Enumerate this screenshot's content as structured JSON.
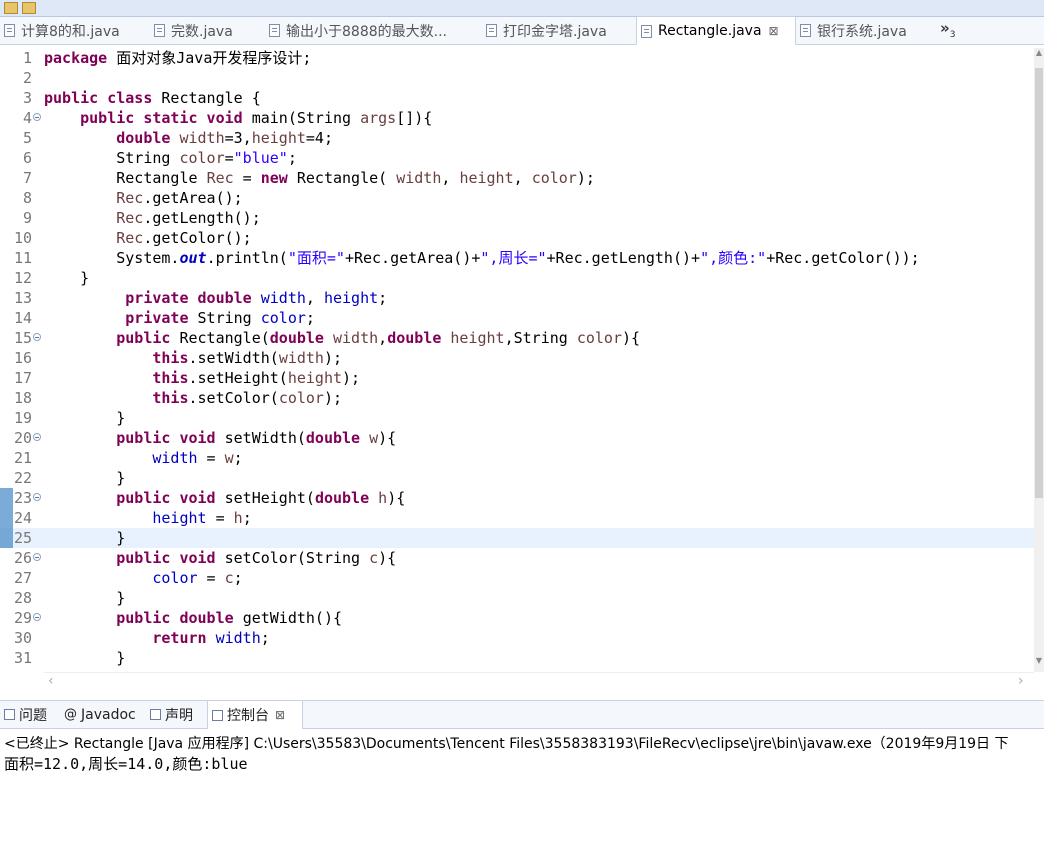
{
  "tabs": [
    {
      "label": "计算8的和.java",
      "active": false
    },
    {
      "label": "完数.java",
      "active": false
    },
    {
      "label": "输出小于8888的最大数...",
      "active": false
    },
    {
      "label": "打印金字塔.java",
      "active": false
    },
    {
      "label": "Rectangle.java",
      "active": true,
      "close": "⊠"
    },
    {
      "label": "银行系统.java",
      "active": false
    }
  ],
  "tabs_overflow": {
    "glyph": "»",
    "count": "3"
  },
  "editor": {
    "current_line": 25,
    "lines": [
      {
        "n": "1",
        "fold": false,
        "mark": false,
        "tokens": [
          [
            "package ",
            "kw"
          ],
          [
            "面对对象Java开发程序设计;",
            "p"
          ]
        ]
      },
      {
        "n": "2",
        "fold": false,
        "mark": false,
        "tokens": []
      },
      {
        "n": "3",
        "fold": false,
        "mark": false,
        "tokens": [
          [
            "public class ",
            "kw"
          ],
          [
            "Rectangle {",
            "p"
          ]
        ]
      },
      {
        "n": "4",
        "fold": true,
        "mark": false,
        "tokens": [
          [
            "    ",
            "p"
          ],
          [
            "public static void ",
            "kw"
          ],
          [
            "main(String ",
            "p"
          ],
          [
            "args",
            "lv"
          ],
          [
            "[]){",
            "p"
          ]
        ]
      },
      {
        "n": "5",
        "fold": false,
        "mark": false,
        "tokens": [
          [
            "        ",
            "p"
          ],
          [
            "double ",
            "kw"
          ],
          [
            "width",
            "lv"
          ],
          [
            "=3,",
            "p"
          ],
          [
            "height",
            "lv"
          ],
          [
            "=4;",
            "p"
          ]
        ]
      },
      {
        "n": "6",
        "fold": false,
        "mark": false,
        "tokens": [
          [
            "        String ",
            "p"
          ],
          [
            "color",
            "lv"
          ],
          [
            "=",
            "p"
          ],
          [
            "\"blue\"",
            "st"
          ],
          [
            ";",
            "p"
          ]
        ]
      },
      {
        "n": "7",
        "fold": false,
        "mark": false,
        "tokens": [
          [
            "        Rectangle ",
            "p"
          ],
          [
            "Rec",
            "lv"
          ],
          [
            " = ",
            "p"
          ],
          [
            "new ",
            "kw"
          ],
          [
            "Rectangle( ",
            "p"
          ],
          [
            "width",
            "lv"
          ],
          [
            ", ",
            "p"
          ],
          [
            "height",
            "lv"
          ],
          [
            ", ",
            "p"
          ],
          [
            "color",
            "lv"
          ],
          [
            ");",
            "p"
          ]
        ]
      },
      {
        "n": "8",
        "fold": false,
        "mark": false,
        "tokens": [
          [
            "        ",
            "p"
          ],
          [
            "Rec",
            "lv"
          ],
          [
            ".getArea();",
            "p"
          ]
        ]
      },
      {
        "n": "9",
        "fold": false,
        "mark": false,
        "tokens": [
          [
            "        ",
            "p"
          ],
          [
            "Rec",
            "lv"
          ],
          [
            ".getLength();",
            "p"
          ]
        ]
      },
      {
        "n": "10",
        "fold": false,
        "mark": false,
        "tokens": [
          [
            "        ",
            "p"
          ],
          [
            "Rec",
            "lv"
          ],
          [
            ".getColor();",
            "p"
          ]
        ]
      },
      {
        "n": "11",
        "fold": false,
        "mark": false,
        "tokens": [
          [
            "        System.",
            "p"
          ],
          [
            "out",
            "sf"
          ],
          [
            ".println(",
            "p"
          ],
          [
            "\"面积=\"",
            "st"
          ],
          [
            "+Rec.getArea()+",
            "p"
          ],
          [
            "\",周长=\"",
            "st"
          ],
          [
            "+Rec.getLength()+",
            "p"
          ],
          [
            "\",颜色:\"",
            "st"
          ],
          [
            "+Rec.getColor());",
            "p"
          ]
        ]
      },
      {
        "n": "12",
        "fold": false,
        "mark": false,
        "tokens": [
          [
            "    }",
            "p"
          ]
        ]
      },
      {
        "n": "13",
        "fold": false,
        "mark": false,
        "tokens": [
          [
            "         ",
            "p"
          ],
          [
            "private double ",
            "kw"
          ],
          [
            "width",
            "fd"
          ],
          [
            ", ",
            "p"
          ],
          [
            "height",
            "fd"
          ],
          [
            ";",
            "p"
          ]
        ]
      },
      {
        "n": "14",
        "fold": false,
        "mark": false,
        "tokens": [
          [
            "         ",
            "p"
          ],
          [
            "private ",
            "kw"
          ],
          [
            "String ",
            "p"
          ],
          [
            "color",
            "fd"
          ],
          [
            ";",
            "p"
          ]
        ]
      },
      {
        "n": "15",
        "fold": true,
        "mark": false,
        "tokens": [
          [
            "        ",
            "p"
          ],
          [
            "public ",
            "kw"
          ],
          [
            "Rectangle(",
            "p"
          ],
          [
            "double ",
            "kw"
          ],
          [
            "width",
            "lv"
          ],
          [
            ",",
            "p"
          ],
          [
            "double ",
            "kw"
          ],
          [
            "height",
            "lv"
          ],
          [
            ",String ",
            "p"
          ],
          [
            "color",
            "lv"
          ],
          [
            "){",
            "p"
          ]
        ]
      },
      {
        "n": "16",
        "fold": false,
        "mark": false,
        "tokens": [
          [
            "            ",
            "p"
          ],
          [
            "this",
            "kw"
          ],
          [
            ".setWidth(",
            "p"
          ],
          [
            "width",
            "lv"
          ],
          [
            ");",
            "p"
          ]
        ]
      },
      {
        "n": "17",
        "fold": false,
        "mark": false,
        "tokens": [
          [
            "            ",
            "p"
          ],
          [
            "this",
            "kw"
          ],
          [
            ".setHeight(",
            "p"
          ],
          [
            "height",
            "lv"
          ],
          [
            ");",
            "p"
          ]
        ]
      },
      {
        "n": "18",
        "fold": false,
        "mark": false,
        "tokens": [
          [
            "            ",
            "p"
          ],
          [
            "this",
            "kw"
          ],
          [
            ".setColor(",
            "p"
          ],
          [
            "color",
            "lv"
          ],
          [
            ");",
            "p"
          ]
        ]
      },
      {
        "n": "19",
        "fold": false,
        "mark": false,
        "tokens": [
          [
            "        }",
            "p"
          ]
        ]
      },
      {
        "n": "20",
        "fold": true,
        "mark": false,
        "tokens": [
          [
            "        ",
            "p"
          ],
          [
            "public void ",
            "kw"
          ],
          [
            "setWidth(",
            "p"
          ],
          [
            "double ",
            "kw"
          ],
          [
            "w",
            "lv"
          ],
          [
            "){",
            "p"
          ]
        ]
      },
      {
        "n": "21",
        "fold": false,
        "mark": false,
        "tokens": [
          [
            "            ",
            "p"
          ],
          [
            "width",
            "fd"
          ],
          [
            " = ",
            "p"
          ],
          [
            "w",
            "lv"
          ],
          [
            ";",
            "p"
          ]
        ]
      },
      {
        "n": "22",
        "fold": false,
        "mark": false,
        "tokens": [
          [
            "        }",
            "p"
          ]
        ]
      },
      {
        "n": "23",
        "fold": true,
        "mark": true,
        "tokens": [
          [
            "        ",
            "p"
          ],
          [
            "public void ",
            "kw"
          ],
          [
            "setHeight(",
            "p"
          ],
          [
            "double ",
            "kw"
          ],
          [
            "h",
            "lv"
          ],
          [
            "){",
            "p"
          ]
        ]
      },
      {
        "n": "24",
        "fold": false,
        "mark": true,
        "tokens": [
          [
            "            ",
            "p"
          ],
          [
            "height",
            "fd"
          ],
          [
            " = ",
            "p"
          ],
          [
            "h",
            "lv"
          ],
          [
            ";",
            "p"
          ]
        ]
      },
      {
        "n": "25",
        "fold": false,
        "mark": true,
        "tokens": [
          [
            "        }",
            "p"
          ]
        ]
      },
      {
        "n": "26",
        "fold": true,
        "mark": false,
        "tokens": [
          [
            "        ",
            "p"
          ],
          [
            "public void ",
            "kw"
          ],
          [
            "setColor(String ",
            "p"
          ],
          [
            "c",
            "lv"
          ],
          [
            "){",
            "p"
          ]
        ]
      },
      {
        "n": "27",
        "fold": false,
        "mark": false,
        "tokens": [
          [
            "            ",
            "p"
          ],
          [
            "color",
            "fd"
          ],
          [
            " = ",
            "p"
          ],
          [
            "c",
            "lv"
          ],
          [
            ";",
            "p"
          ]
        ]
      },
      {
        "n": "28",
        "fold": false,
        "mark": false,
        "tokens": [
          [
            "        }",
            "p"
          ]
        ]
      },
      {
        "n": "29",
        "fold": true,
        "mark": false,
        "tokens": [
          [
            "        ",
            "p"
          ],
          [
            "public double ",
            "kw"
          ],
          [
            "getWidth(){",
            "p"
          ]
        ]
      },
      {
        "n": "30",
        "fold": false,
        "mark": false,
        "tokens": [
          [
            "            ",
            "p"
          ],
          [
            "return ",
            "kw"
          ],
          [
            "width",
            "fd"
          ],
          [
            ";",
            "p"
          ]
        ]
      },
      {
        "n": "31",
        "fold": false,
        "mark": false,
        "tokens": [
          [
            "        }",
            "p"
          ]
        ]
      }
    ]
  },
  "syntax_colors": {
    "kw": "#7f0055",
    "lv": "#6a3e3e",
    "fd": "#0000c0",
    "st": "#2a00ff",
    "sf": "#0000c0",
    "p": "#000000"
  },
  "view_tabs": [
    {
      "label": "问题",
      "icon": "problems-icon",
      "active": false
    },
    {
      "label": "Javadoc",
      "icon": "at-icon",
      "active": false
    },
    {
      "label": "声明",
      "icon": "declaration-icon",
      "active": false
    },
    {
      "label": "控制台",
      "icon": "console-icon",
      "active": true,
      "close": "⊠"
    }
  ],
  "console": {
    "header": "<已终止> Rectangle [Java 应用程序] C:\\Users\\35583\\Documents\\Tencent Files\\3558383193\\FileRecv\\eclipse\\jre\\bin\\javaw.exe（2019年9月19日 下",
    "output": "面积=12.0,周长=14.0,颜色:blue"
  }
}
